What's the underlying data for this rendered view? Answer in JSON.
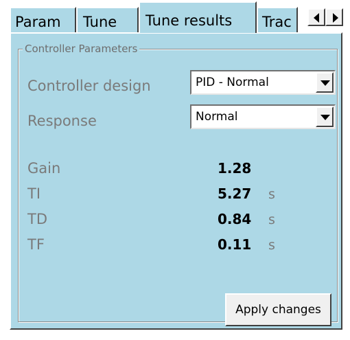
{
  "tabs": [
    {
      "label": "Param"
    },
    {
      "label": "Tune"
    },
    {
      "label": "Tune results",
      "active": true
    },
    {
      "label": "Trac"
    }
  ],
  "tab_scroll": {
    "left_icon": "arrow-left-icon",
    "right_icon": "arrow-right-icon"
  },
  "group": {
    "title": "Controller Parameters"
  },
  "controller_design": {
    "label": "Controller design",
    "value": "PID - Normal"
  },
  "response": {
    "label": "Response",
    "value": "Normal"
  },
  "parameters": [
    {
      "label": "Gain",
      "value": "1.28",
      "unit": ""
    },
    {
      "label": "TI",
      "value": "5.27",
      "unit": "s"
    },
    {
      "label": "TD",
      "value": "0.84",
      "unit": "s"
    },
    {
      "label": "TF",
      "value": "0.11",
      "unit": "s"
    }
  ],
  "apply_button": {
    "label": "Apply changes"
  },
  "colors": {
    "panel_background": "#add8e6",
    "label_text": "#7a7a7a",
    "value_text": "#000000"
  }
}
